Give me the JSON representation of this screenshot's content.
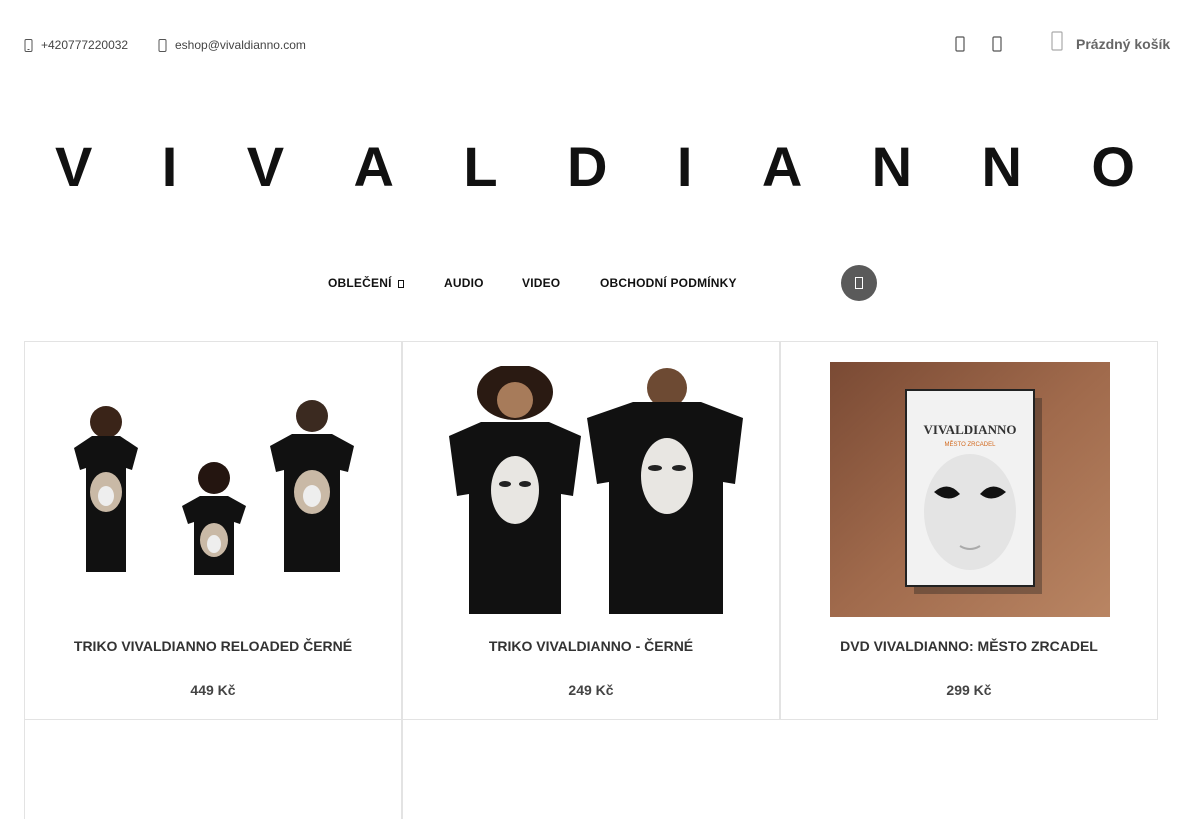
{
  "header": {
    "phone": "+420777220032",
    "email": "eshop@vivaldianno.com",
    "cart_label": "Prázdný košík"
  },
  "logo": {
    "letters": [
      "V",
      "I",
      "V",
      "A",
      "L",
      "D",
      "I",
      "A",
      "N",
      "N",
      "O"
    ]
  },
  "nav": {
    "items": [
      "OBLEČENÍ",
      "AUDIO",
      "VIDEO",
      "OBCHODNÍ PODMÍNKY"
    ]
  },
  "products": [
    {
      "name": "TRIKO VIVALDIANNO RELOADED ČERNÉ",
      "price": "449 Kč"
    },
    {
      "name": "TRIKO VIVALDIANNO - ČERNÉ",
      "price": "249 Kč"
    },
    {
      "name": "DVD VIVALDIANNO: MĚSTO ZRCADEL",
      "price": "299 Kč",
      "cover_title": "VIVALDIANNO",
      "cover_subtitle": "MĚSTO ZRCADEL"
    }
  ]
}
